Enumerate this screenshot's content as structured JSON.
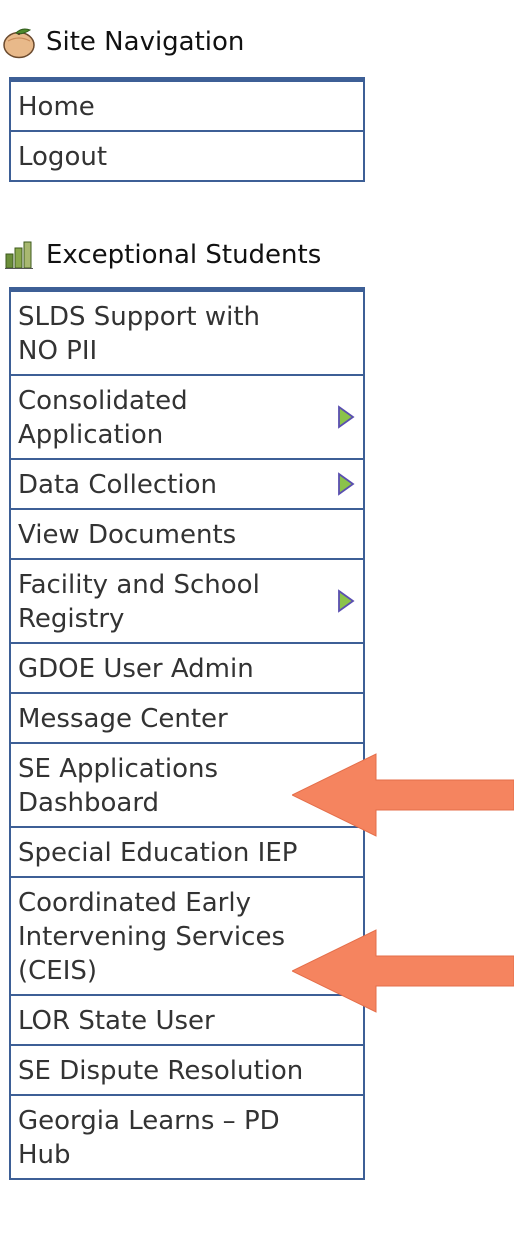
{
  "site_navigation": {
    "title": "Site Navigation",
    "icon": "peach-icon",
    "items": [
      {
        "label": "Home"
      },
      {
        "label": "Logout"
      }
    ]
  },
  "exceptional_students": {
    "title": "Exceptional Students",
    "icon": "bar-chart-icon",
    "items": [
      {
        "label": "SLDS Support with NO PII",
        "submenu": false
      },
      {
        "label": "Consolidated Application",
        "submenu": true
      },
      {
        "label": "Data Collection",
        "submenu": true
      },
      {
        "label": "View Documents",
        "submenu": false
      },
      {
        "label": "Facility and School Registry",
        "submenu": true
      },
      {
        "label": "GDOE User Admin",
        "submenu": false
      },
      {
        "label": "Message Center",
        "submenu": false
      },
      {
        "label": "SE Applications Dashboard",
        "submenu": false
      },
      {
        "label": "Special Education IEP",
        "submenu": false
      },
      {
        "label": "Coordinated Early Intervening Services (CEIS)",
        "submenu": false
      },
      {
        "label": "LOR State User",
        "submenu": false
      },
      {
        "label": "SE Dispute Resolution",
        "submenu": false
      },
      {
        "label": "Georgia Learns – PD Hub",
        "submenu": false
      }
    ]
  },
  "annotations": {
    "arrow_color": "#f5845f",
    "highlighted_items": [
      "SE Applications Dashboard",
      "Coordinated Early Intervening Services (CEIS)"
    ]
  },
  "colors": {
    "menu_border": "#3d5f96",
    "submenu_arrow": "#8bc34a",
    "text": "#333333"
  }
}
